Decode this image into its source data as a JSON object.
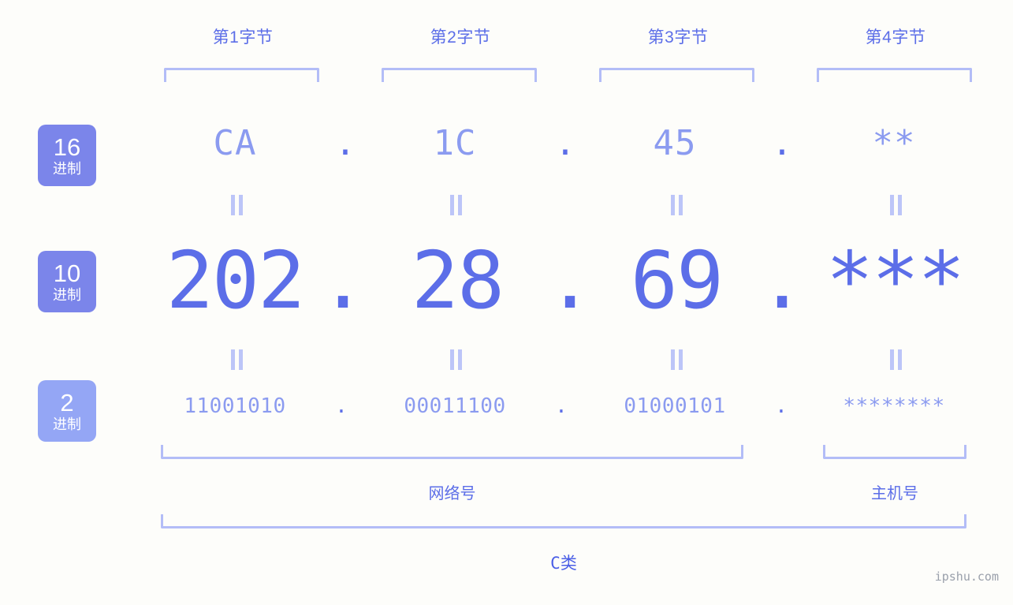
{
  "background_color": "#fdfdfa",
  "accent_color": "#5c6ee8",
  "muted_color": "#8b9bf0",
  "bracket_color": "#b3bdf7",
  "byte_headers": [
    {
      "label": "第1字节"
    },
    {
      "label": "第2字节"
    },
    {
      "label": "第3字节"
    },
    {
      "label": "第4字节"
    }
  ],
  "rows": [
    {
      "badge_number": "16",
      "badge_unit": "进制",
      "badge_color": "#7b85ea",
      "values": [
        "CA",
        "1C",
        "45",
        "**"
      ],
      "separator": "."
    },
    {
      "badge_number": "10",
      "badge_unit": "进制",
      "badge_color": "#7b85ea",
      "values": [
        "202",
        "28",
        "69",
        "***"
      ],
      "separator": "."
    },
    {
      "badge_number": "2",
      "badge_unit": "进制",
      "badge_color": "#94a6f5",
      "values": [
        "11001010",
        "00011100",
        "01000101",
        "********"
      ],
      "separator": "."
    }
  ],
  "equals_symbol": "=",
  "footer": {
    "network_label": "网络号",
    "host_label": "主机号",
    "class_label": "C类",
    "watermark": "ipshu.com"
  }
}
